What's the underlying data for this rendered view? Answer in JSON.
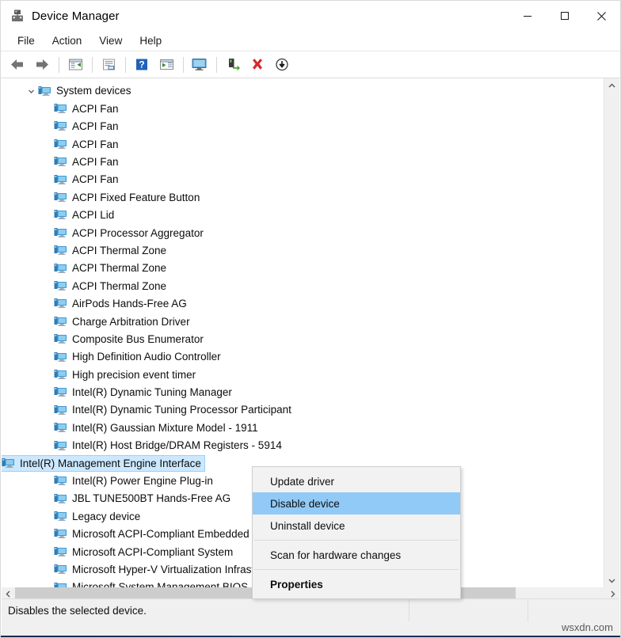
{
  "window": {
    "title": "Device Manager",
    "icon": "device-manager-icon",
    "controls": {
      "minimize": "—",
      "maximize": "☐",
      "close": "✕"
    }
  },
  "menubar": {
    "items": [
      {
        "label": "File",
        "name": "menu-file"
      },
      {
        "label": "Action",
        "name": "menu-action"
      },
      {
        "label": "View",
        "name": "menu-view"
      },
      {
        "label": "Help",
        "name": "menu-help"
      }
    ]
  },
  "toolbar": {
    "buttons": [
      {
        "name": "back-icon",
        "title": "Back"
      },
      {
        "name": "forward-icon",
        "title": "Forward"
      },
      {
        "name": "show-hide-console-tree-icon",
        "title": "Show/Hide Console Tree"
      },
      {
        "name": "properties-icon",
        "title": "Properties"
      },
      {
        "name": "help-icon",
        "title": "Help"
      },
      {
        "name": "update-driver-icon",
        "title": "Update driver"
      },
      {
        "name": "scan-for-hardware-changes-icon",
        "title": "Scan for hardware changes"
      },
      {
        "name": "enable-device-icon",
        "title": "Enable device"
      },
      {
        "name": "uninstall-device-icon",
        "title": "Uninstall device"
      },
      {
        "name": "disable-device-icon",
        "title": "Disable device"
      }
    ]
  },
  "tree": {
    "root": {
      "label": "System devices",
      "expanded": true,
      "icon": "device-icon"
    },
    "items": [
      {
        "label": "ACPI Fan",
        "selected": false
      },
      {
        "label": "ACPI Fan",
        "selected": false
      },
      {
        "label": "ACPI Fan",
        "selected": false
      },
      {
        "label": "ACPI Fan",
        "selected": false
      },
      {
        "label": "ACPI Fan",
        "selected": false
      },
      {
        "label": "ACPI Fixed Feature Button",
        "selected": false
      },
      {
        "label": "ACPI Lid",
        "selected": false
      },
      {
        "label": "ACPI Processor Aggregator",
        "selected": false
      },
      {
        "label": "ACPI Thermal Zone",
        "selected": false
      },
      {
        "label": "ACPI Thermal Zone",
        "selected": false
      },
      {
        "label": "ACPI Thermal Zone",
        "selected": false
      },
      {
        "label": "AirPods Hands-Free AG",
        "selected": false
      },
      {
        "label": "Charge Arbitration Driver",
        "selected": false
      },
      {
        "label": "Composite Bus Enumerator",
        "selected": false
      },
      {
        "label": "High Definition Audio Controller",
        "selected": false
      },
      {
        "label": "High precision event timer",
        "selected": false
      },
      {
        "label": "Intel(R) Dynamic Tuning Manager",
        "selected": false
      },
      {
        "label": "Intel(R) Dynamic Tuning Processor Participant",
        "selected": false
      },
      {
        "label": "Intel(R) Gaussian Mixture Model - 1911",
        "selected": false
      },
      {
        "label": "Intel(R) Host Bridge/DRAM Registers - 5914",
        "selected": false
      },
      {
        "label": "Intel(R) Management Engine Interface",
        "selected": true
      },
      {
        "label": "Intel(R) Power Engine Plug-in",
        "selected": false
      },
      {
        "label": "JBL TUNE500BT Hands-Free AG",
        "selected": false
      },
      {
        "label": "Legacy device",
        "selected": false
      },
      {
        "label": "Microsoft ACPI-Compliant Embedded Controller",
        "selected": false
      },
      {
        "label": "Microsoft ACPI-Compliant System",
        "selected": false
      },
      {
        "label": "Microsoft Hyper-V Virtualization Infrastructure Driver",
        "selected": false
      },
      {
        "label": "Microsoft System Management BIOS Driver",
        "selected": false
      }
    ]
  },
  "context_menu": {
    "items": [
      {
        "label": "Update driver",
        "highlighted": false,
        "bold": false,
        "separator_after": false
      },
      {
        "label": "Disable device",
        "highlighted": true,
        "bold": false,
        "separator_after": false
      },
      {
        "label": "Uninstall device",
        "highlighted": false,
        "bold": false,
        "separator_after": true
      },
      {
        "label": "Scan for hardware changes",
        "highlighted": false,
        "bold": false,
        "separator_after": true
      },
      {
        "label": "Properties",
        "highlighted": false,
        "bold": true,
        "separator_after": false
      }
    ]
  },
  "statusbar": {
    "message": "Disables the selected device.",
    "cell2": "",
    "cell3": ""
  },
  "watermark": "wsxdn.com",
  "scrollbars": {
    "vertical": {
      "up_arrow": "⌃",
      "down_arrow": "⌄"
    },
    "horizontal": {
      "left_arrow": "‹",
      "right_arrow": "›"
    }
  },
  "colors": {
    "selection": "#cce8ff",
    "menu_highlight": "#91c9f7",
    "device_icon_blue": "#3c9ad6"
  }
}
